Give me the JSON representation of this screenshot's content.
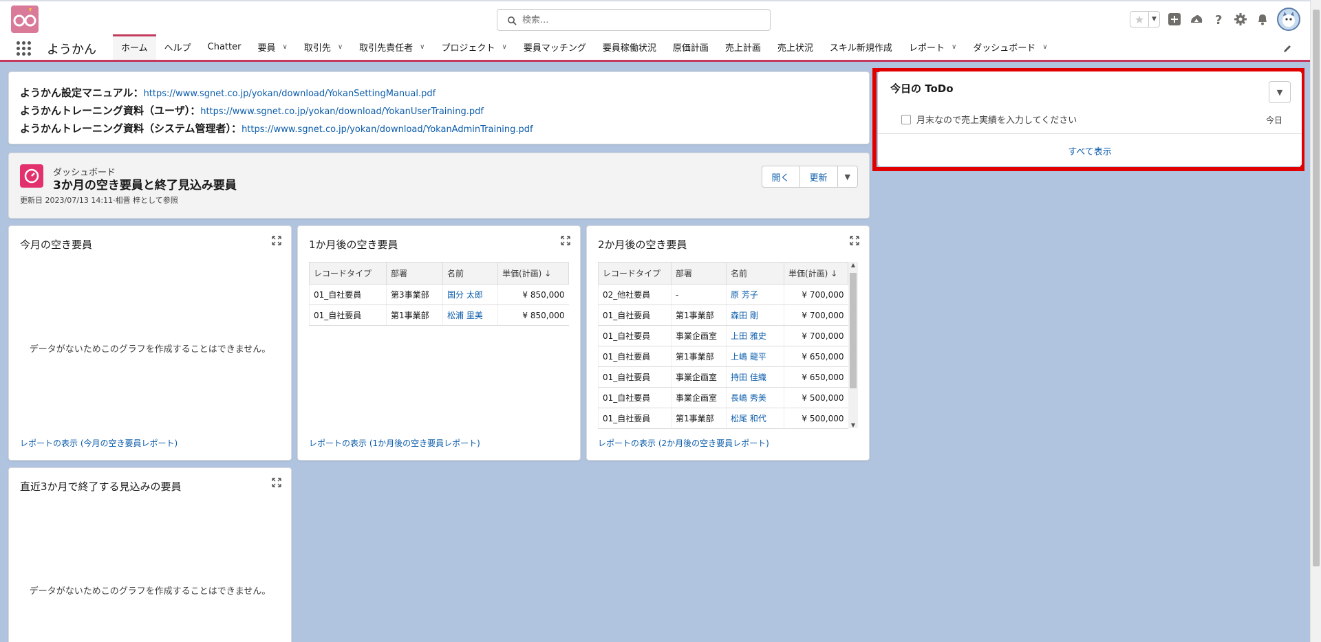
{
  "header": {
    "search_placeholder": "検索...",
    "icons": [
      "star-icon",
      "add-icon",
      "trailhead-icon",
      "help-icon",
      "setup-gear-icon",
      "notification-bell-icon",
      "avatar"
    ]
  },
  "nav": {
    "app_name": "ようかん",
    "tabs": [
      {
        "label": "ホーム",
        "active": true,
        "dropdown": false
      },
      {
        "label": "ヘルプ",
        "dropdown": false
      },
      {
        "label": "Chatter",
        "dropdown": false
      },
      {
        "label": "要員",
        "dropdown": true
      },
      {
        "label": "取引先",
        "dropdown": true
      },
      {
        "label": "取引先責任者",
        "dropdown": true
      },
      {
        "label": "プロジェクト",
        "dropdown": true
      },
      {
        "label": "要員マッチング",
        "dropdown": false
      },
      {
        "label": "要員稼働状況",
        "dropdown": false
      },
      {
        "label": "原価計画",
        "dropdown": false
      },
      {
        "label": "売上計画",
        "dropdown": false
      },
      {
        "label": "売上状況",
        "dropdown": false
      },
      {
        "label": "スキル新規作成",
        "dropdown": false
      },
      {
        "label": "レポート",
        "dropdown": true
      },
      {
        "label": "ダッシュボード",
        "dropdown": true
      }
    ]
  },
  "links": [
    {
      "label": "ようかん設定マニュアル：",
      "url": "https://www.sgnet.co.jp/yokan/download/YokanSettingManual.pdf"
    },
    {
      "label": "ようかんトレーニング資料（ユーザ）：",
      "url": "https://www.sgnet.co.jp/yokan/download/YokanUserTraining.pdf"
    },
    {
      "label": "ようかんトレーニング資料（システム管理者）：",
      "url": "https://www.sgnet.co.jp/yokan/download/YokanAdminTraining.pdf"
    }
  ],
  "dashboard": {
    "label": "ダッシュボード",
    "title": "3か月の空き要員と終了見込み要員",
    "meta": "更新日 2023/07/13 14:11·相晋 梓として参照",
    "open_button": "開く",
    "refresh_button": "更新"
  },
  "panels": {
    "this_month": {
      "title": "今月の空き要員",
      "empty": "データがないためこのグラフを作成することはできません。",
      "link": "レポートの表示 (今月の空き要員レポート)"
    },
    "one_month": {
      "title": "1か月後の空き要員",
      "columns": [
        "レコードタイプ",
        "部署",
        "名前",
        "単価(計画)"
      ],
      "rows": [
        [
          "01_自社要員",
          "第3事業部",
          "国分 太郎",
          "¥ 850,000"
        ],
        [
          "01_自社要員",
          "第1事業部",
          "松浦 里美",
          "¥ 850,000"
        ]
      ],
      "link": "レポートの表示 (1か月後の空き要員レポート)"
    },
    "two_month": {
      "title": "2か月後の空き要員",
      "columns": [
        "レコードタイプ",
        "部署",
        "名前",
        "単価(計画)"
      ],
      "rows": [
        [
          "02_他社要員",
          "-",
          "原 芳子",
          "¥ 700,000"
        ],
        [
          "01_自社要員",
          "第1事業部",
          "森田 剛",
          "¥ 700,000"
        ],
        [
          "01_自社要員",
          "事業企画室",
          "上田 雅史",
          "¥ 700,000"
        ],
        [
          "01_自社要員",
          "第1事業部",
          "上嶋 龍平",
          "¥ 650,000"
        ],
        [
          "01_自社要員",
          "事業企画室",
          "持田 佳織",
          "¥ 650,000"
        ],
        [
          "01_自社要員",
          "事業企画室",
          "長嶋 秀美",
          "¥ 500,000"
        ],
        [
          "01_自社要員",
          "第1事業部",
          "松尾 和代",
          "¥ 500,000"
        ]
      ],
      "link": "レポートの表示 (2か月後の空き要員レポート)"
    },
    "ending": {
      "title": "直近3か月で終了する見込みの要員",
      "empty": "データがないためこのグラフを作成することはできません。"
    }
  },
  "todo": {
    "title": "今日の ToDo",
    "task": "月末なので売上実績を入力してください",
    "due": "今日",
    "view_all": "すべて表示"
  },
  "colors": {
    "brand": "#c23a5d",
    "highlight": "#e00000",
    "link": "#0b5cab",
    "background": "#b0c4df"
  }
}
